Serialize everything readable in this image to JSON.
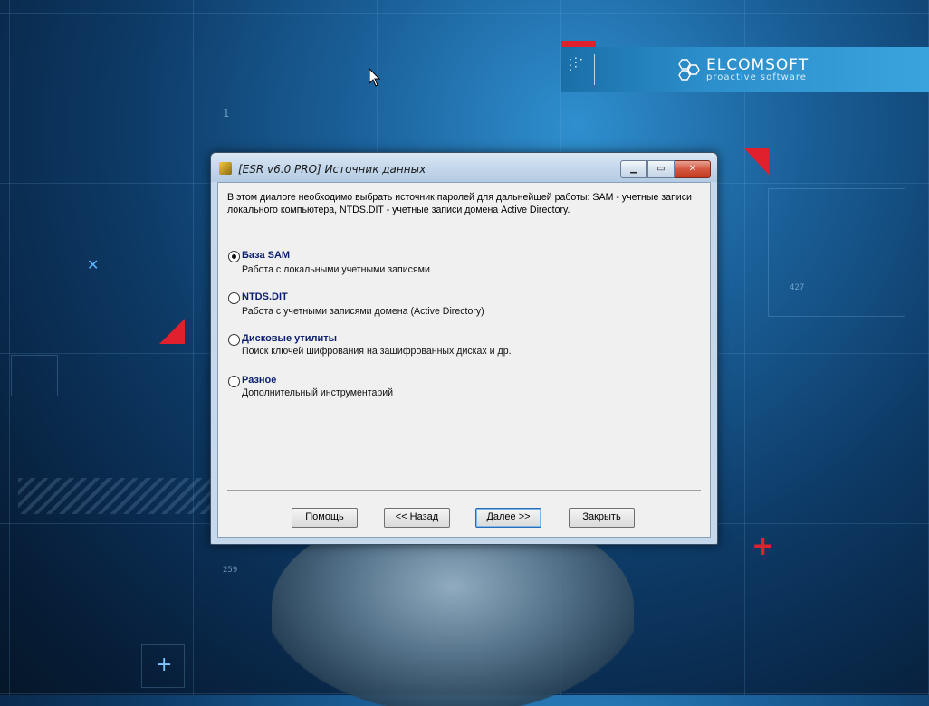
{
  "desktop": {
    "brand": {
      "name": "ELCOMSOFT",
      "tagline": "proactive software"
    },
    "deco_numbers": [
      "1",
      "427",
      "259"
    ]
  },
  "dialog": {
    "title": "[ESR v6.0 PRO]  Источник данных",
    "description": "В этом диалоге необходимо выбрать источник паролей для дальнейшей работы: SAM - учетные записи локального компьютера, NTDS.DIT - учетные записи домена Active Directory.",
    "options": [
      {
        "title": "База SAM",
        "subtitle": "Работа с локальными учетными записями",
        "selected": true
      },
      {
        "title": "NTDS.DIT",
        "subtitle": "Работа с учетными записями домена (Active Directory)",
        "selected": false
      },
      {
        "title": "Дисковые утилиты",
        "subtitle": "Поиск ключей шифрования на зашифрованных дисках и др.",
        "selected": false
      },
      {
        "title": "Разное",
        "subtitle": "Дополнительный инструментарий",
        "selected": false
      }
    ],
    "buttons": {
      "help": "Помощь",
      "back": "<< Назад",
      "next": "Далее >>",
      "close": "Закрыть"
    }
  }
}
